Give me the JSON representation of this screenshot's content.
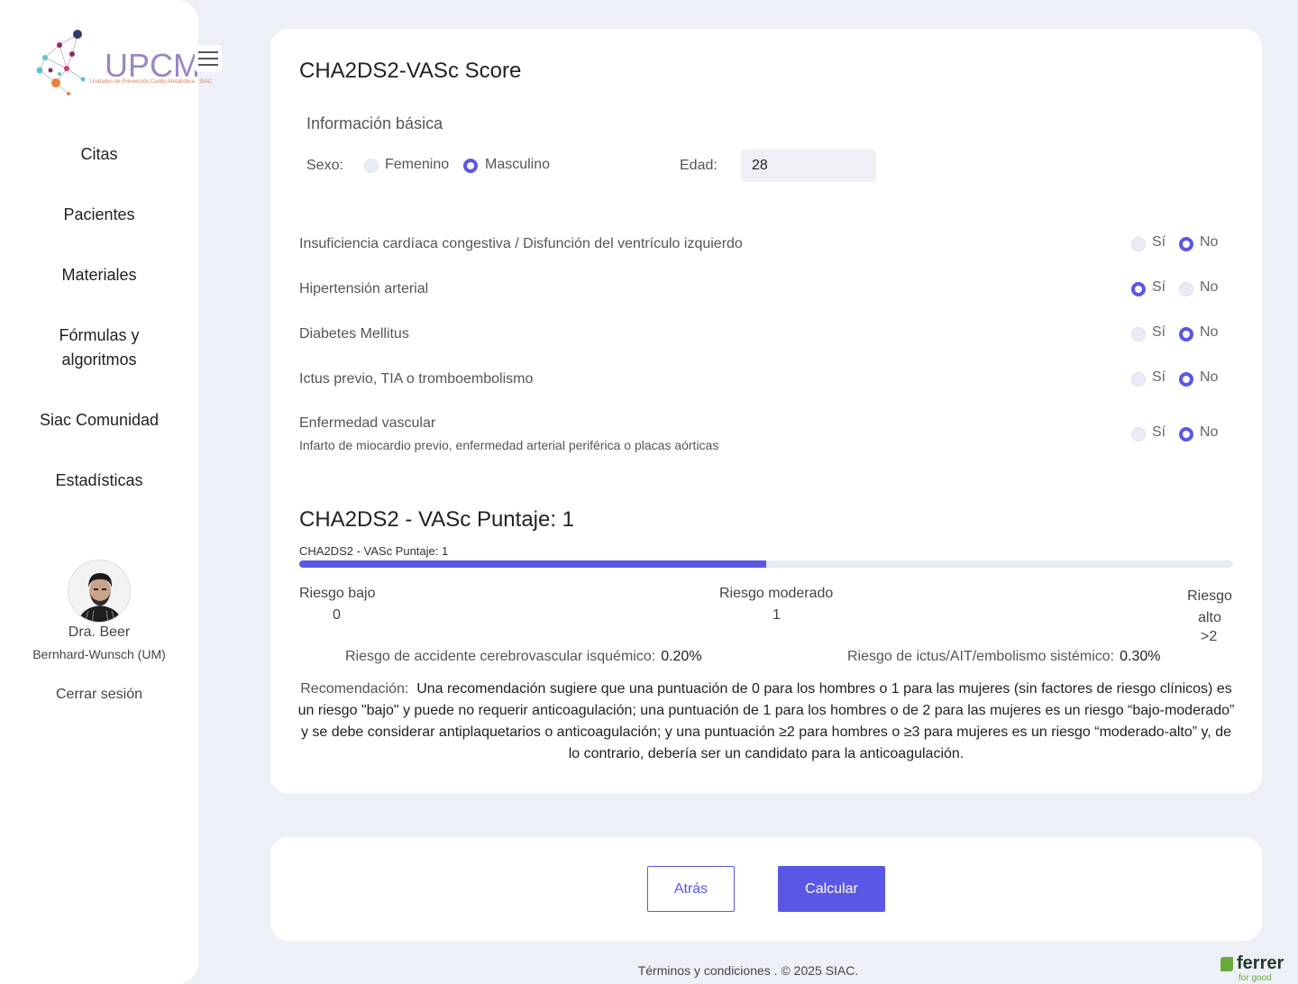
{
  "sidebar": {
    "logo_text": "UPCM",
    "logo_sub": "Unidades de Prevención Cardio-Metabólica · SIAC",
    "nav": [
      {
        "label": "Citas"
      },
      {
        "label": "Pacientes"
      },
      {
        "label": "Materiales"
      },
      {
        "label": "Fórmulas y algoritmos"
      },
      {
        "label": "Siac Comunidad"
      },
      {
        "label": "Estadísticas"
      }
    ],
    "user_name": "Dra. Beer",
    "user_org": "Bernhard-Wunsch (UM)",
    "logout": "Cerrar sesión"
  },
  "page": {
    "title": "CHA2DS2-VASc Score",
    "section_basic": "Información básica",
    "sex_label": "Sexo:",
    "sex_options": [
      "Femenino",
      "Masculino"
    ],
    "sex_selected": "Masculino",
    "age_label": "Edad:",
    "age_value": "28"
  },
  "questions": [
    {
      "label": "Insuficiencia cardíaca congestiva / Disfunción del ventrículo izquierdo",
      "sub": "",
      "yes": "Sí",
      "no": "No",
      "selected": "No"
    },
    {
      "label": "Hipertensión arterial",
      "sub": "",
      "yes": "Sí",
      "no": "No",
      "selected": "Sí"
    },
    {
      "label": "Diabetes Mellitus",
      "sub": "",
      "yes": "Sí",
      "no": "No",
      "selected": "No"
    },
    {
      "label": "Ictus previo, TIA o tromboembolismo",
      "sub": "",
      "yes": "Sí",
      "no": "No",
      "selected": "No"
    },
    {
      "label": "Enfermedad vascular",
      "sub": "Infarto de miocardio previo, enfermedad arterial periférica o placas aórticas",
      "yes": "Sí",
      "no": "No",
      "selected": "No"
    }
  ],
  "score": {
    "title": "CHA2DS2 - VASc Puntaje: 1",
    "bar_label": "CHA2DS2 - VASc Puntaje: 1",
    "progress": 0.5,
    "bar_color": "#5a57e6",
    "risks": [
      {
        "label": "Riesgo bajo",
        "value": "0"
      },
      {
        "label": "Riesgo moderado",
        "value": "1"
      },
      {
        "label": "Riesgo alto",
        "value": ">2"
      }
    ],
    "stat1_label": "Riesgo de accidente cerebrovascular isquémico:",
    "stat1_value": "0.20%",
    "stat2_label": "Riesgo de ictus/AIT/embolismo sistémico:",
    "stat2_value": "0.30%",
    "recom_label": "Recomendación:",
    "recom_text": "Una recomendación sugiere que una puntuación de 0 para los hombres o 1 para las mujeres (sin factores de riesgo clínicos) es un riesgo \"bajo\" y puede no requerir anticoagulación; una puntuación de 1 para los hombres o de 2 para las mujeres es un riesgo “bajo-moderado” y se debe considerar antiplaquetarios o anticoagulación; y una puntuación ≥2 para hombres o ≥3 para mujeres es un riesgo “moderado-alto” y, de lo contrario, debería ser un candidato para la anticoagulación."
  },
  "actions": {
    "back": "Atrás",
    "calc": "Calcular"
  },
  "footer": {
    "text": "Términos y condiciones . © 2025 SIAC.",
    "brand": "ferrer",
    "brand_sub": "for good"
  }
}
